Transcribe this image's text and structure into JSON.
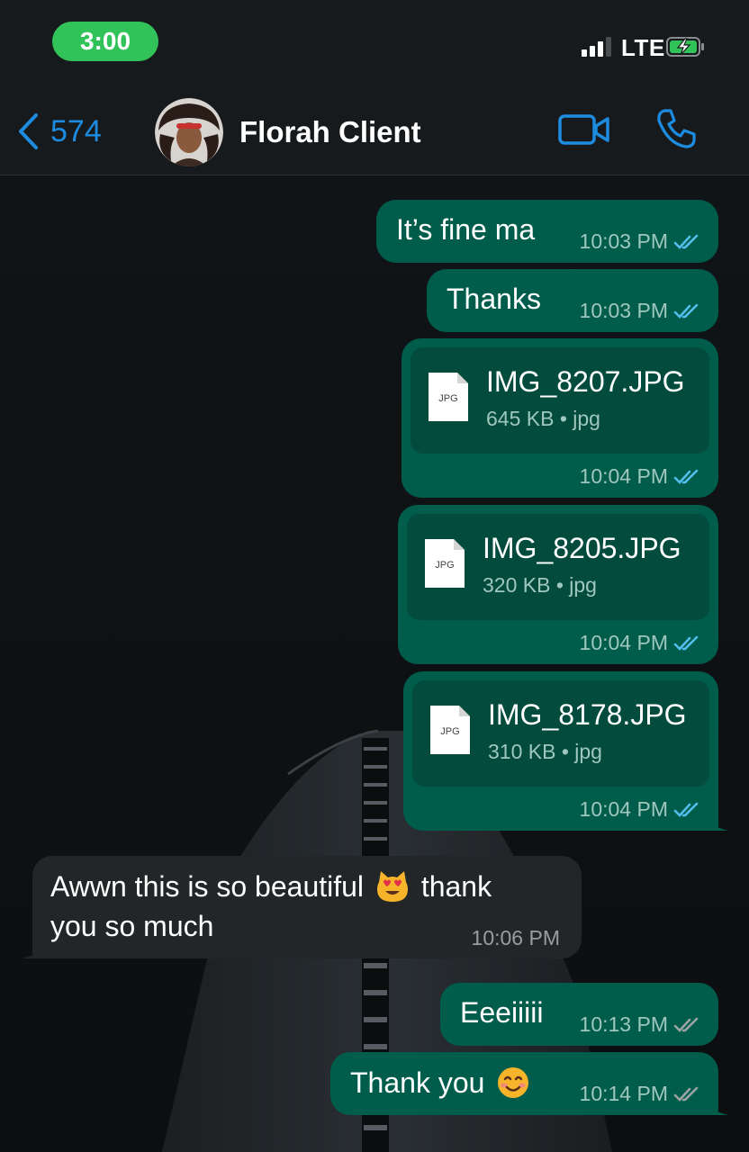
{
  "status_bar": {
    "time": "3:00",
    "network": "LTE",
    "signal_bars": 3,
    "battery_state": "charging"
  },
  "header": {
    "back_icon": "chevron-left-icon",
    "back_count": "574",
    "contact_name": "Florah Client",
    "video_icon": "video-camera-icon",
    "call_icon": "phone-icon"
  },
  "colors": {
    "accent": "#1d8ce0",
    "outgoing_bubble": "#005c4b",
    "incoming_bubble": "#232628",
    "read_ticks": "#53bdeb",
    "delivered_ticks": "#9aa4a2",
    "time_pill": "#31c25a"
  },
  "messages": [
    {
      "direction": "out",
      "text": "It’s fine ma",
      "time": "10:03 PM",
      "status": "read"
    },
    {
      "direction": "out",
      "text": "Thanks",
      "time": "10:03 PM",
      "status": "read"
    },
    {
      "direction": "out",
      "type": "file",
      "file_badge": "JPG",
      "file_name": "IMG_8207.JPG",
      "file_info": "645 KB • jpg",
      "time": "10:04 PM",
      "status": "read"
    },
    {
      "direction": "out",
      "type": "file",
      "file_badge": "JPG",
      "file_name": "IMG_8205.JPG",
      "file_info": "320 KB • jpg",
      "time": "10:04 PM",
      "status": "read"
    },
    {
      "direction": "out",
      "type": "file",
      "file_badge": "JPG",
      "file_name": "IMG_8178.JPG",
      "file_info": "310 KB • jpg",
      "time": "10:04 PM",
      "status": "read"
    },
    {
      "direction": "in",
      "text_line1_a": "Awwn this is so beautiful",
      "emoji": "heart-eyes-cat-emoji",
      "text_line1_b": "thank",
      "text_line2": "you so much",
      "time": "10:06 PM"
    },
    {
      "direction": "out",
      "text": "Eeeiiiii",
      "time": "10:13 PM",
      "status": "delivered"
    },
    {
      "direction": "out",
      "text": "Thank you",
      "emoji": "smiling-face-emoji",
      "time": "10:14 PM",
      "status": "delivered"
    }
  ]
}
